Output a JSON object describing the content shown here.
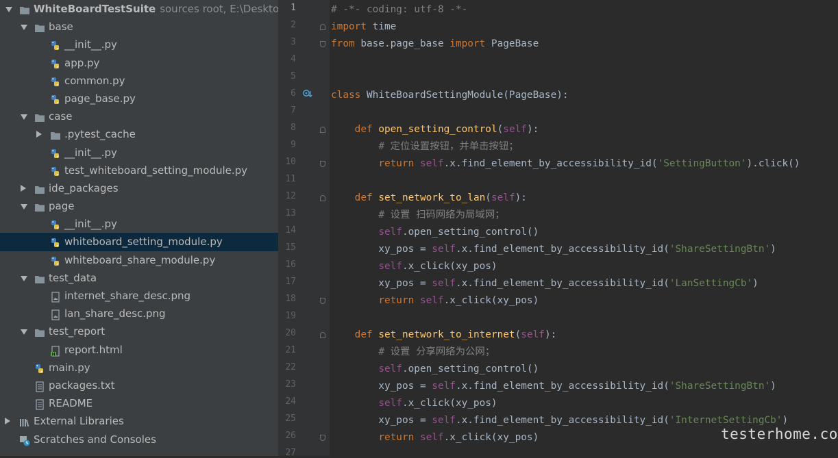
{
  "project_tree": {
    "root": {
      "name": "WhiteBoardTestSuite",
      "hint": "sources root,  E:\\Desktop\\"
    },
    "items": [
      {
        "label": "base",
        "type": "folder",
        "depth": 1,
        "expanded": true
      },
      {
        "label": "__init__.py",
        "type": "py",
        "depth": 2
      },
      {
        "label": "app.py",
        "type": "py",
        "depth": 2
      },
      {
        "label": "common.py",
        "type": "py",
        "depth": 2
      },
      {
        "label": "page_base.py",
        "type": "py",
        "depth": 2
      },
      {
        "label": "case",
        "type": "folder",
        "depth": 1,
        "expanded": true
      },
      {
        "label": ".pytest_cache",
        "type": "folder",
        "depth": 2,
        "expanded": false
      },
      {
        "label": "__init__.py",
        "type": "py",
        "depth": 2
      },
      {
        "label": "test_whiteboard_setting_module.py",
        "type": "py",
        "depth": 2
      },
      {
        "label": "ide_packages",
        "type": "folder",
        "depth": 1,
        "expanded": false
      },
      {
        "label": "page",
        "type": "folder",
        "depth": 1,
        "expanded": true
      },
      {
        "label": "__init__.py",
        "type": "py",
        "depth": 2
      },
      {
        "label": "whiteboard_setting_module.py",
        "type": "py",
        "depth": 2,
        "selected": true
      },
      {
        "label": "whiteboard_share_module.py",
        "type": "py",
        "depth": 2
      },
      {
        "label": "test_data",
        "type": "folder",
        "depth": 1,
        "expanded": true
      },
      {
        "label": "internet_share_desc.png",
        "type": "image",
        "depth": 2
      },
      {
        "label": "lan_share_desc.png",
        "type": "image",
        "depth": 2
      },
      {
        "label": "test_report",
        "type": "folder",
        "depth": 1,
        "expanded": true
      },
      {
        "label": "report.html",
        "type": "html",
        "depth": 2
      },
      {
        "label": "main.py",
        "type": "py",
        "depth": 1
      },
      {
        "label": "packages.txt",
        "type": "text",
        "depth": 1
      },
      {
        "label": "README",
        "type": "text",
        "depth": 1
      },
      {
        "label": "External Libraries",
        "type": "libraries",
        "depth": 0,
        "expanded": false
      },
      {
        "label": "Scratches and Consoles",
        "type": "scratches",
        "depth": 0
      }
    ]
  },
  "editor": {
    "line_numbers": [
      "1",
      "2",
      "3",
      "4",
      "5",
      "6",
      "7",
      "8",
      "9",
      "10",
      "11",
      "12",
      "13",
      "14",
      "15",
      "16",
      "17",
      "18",
      "19",
      "20",
      "21",
      "22",
      "23",
      "24",
      "25",
      "26",
      "27"
    ],
    "lines": [
      "# -*- coding: utf-8 -*-",
      "import time",
      "from base.page_base import PageBase",
      "",
      "",
      "class WhiteBoardSettingModule(PageBase):",
      "",
      "    def open_setting_control(self):",
      "        # 定位设置按钮，并单击按钮；",
      "        return self.x.find_element_by_accessibility_id('SettingButton').click()",
      "",
      "    def set_network_to_lan(self):",
      "        # 设置 扫码网络为局域网；",
      "        self.open_setting_control()",
      "        xy_pos = self.x.find_element_by_accessibility_id('ShareSettingBtn')",
      "        self.x_click(xy_pos)",
      "        xy_pos = self.x.find_element_by_accessibility_id('LanSettingCb')",
      "        return self.x_click(xy_pos)",
      "",
      "    def set_network_to_internet(self):",
      "        # 设置 分享网络为公网；",
      "        self.open_setting_control()",
      "        xy_pos = self.x.find_element_by_accessibility_id('ShareSettingBtn')",
      "        self.x_click(xy_pos)",
      "        xy_pos = self.x.find_element_by_accessibility_id('InternetSettingCb')",
      "        return self.x_click(xy_pos)",
      ""
    ]
  },
  "watermark": "testerhome.com",
  "colors": {
    "keyword": "#cc7832",
    "comment": "#808080",
    "function": "#ffc66d",
    "string": "#6a8759",
    "self": "#94558d",
    "text": "#a9b7c6",
    "selection": "#0d293e"
  }
}
